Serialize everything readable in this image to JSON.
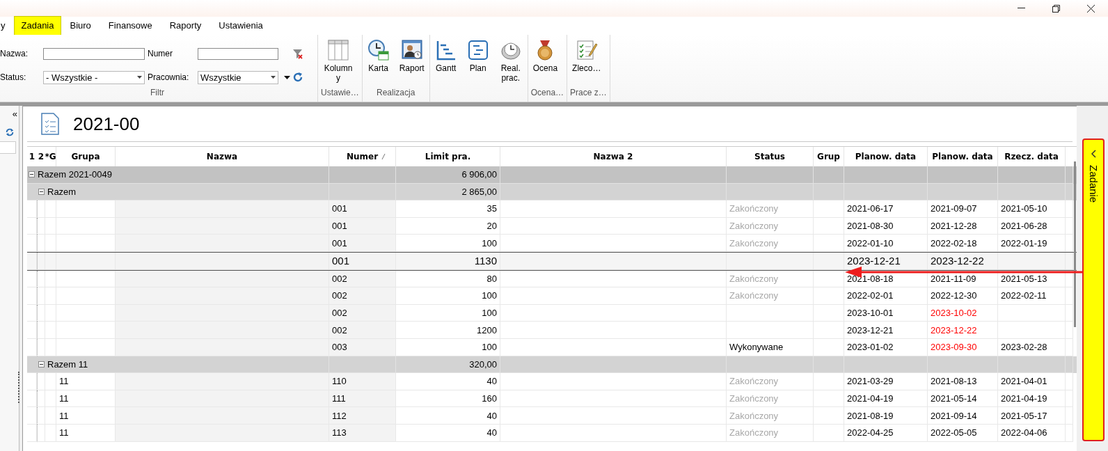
{
  "ribbon": {
    "tabs": [
      {
        "label": "y",
        "selected": false
      },
      {
        "label": "Zadania",
        "selected": true
      },
      {
        "label": "Biuro",
        "selected": false
      },
      {
        "label": "Finansowe",
        "selected": false
      },
      {
        "label": "Raporty",
        "selected": false
      },
      {
        "label": "Ustawienia",
        "selected": false
      }
    ],
    "filter": {
      "label": "Filtr",
      "fields": [
        {
          "kind": "text",
          "label": "Nazwa:"
        },
        {
          "kind": "text",
          "label": "Numer"
        },
        {
          "kind": "dropdown",
          "label": "Status:",
          "value": "- Wszystkie -"
        },
        {
          "kind": "dropdown",
          "label": "Pracownia:",
          "value": "Wszystkie"
        }
      ]
    },
    "groups": [
      {
        "label": "Ustawie…",
        "buttons": [
          {
            "kind": "columns",
            "label": "Kolumny"
          }
        ]
      },
      {
        "label": "Realizacja",
        "buttons": [
          {
            "kind": "calendar",
            "label": "Karta"
          },
          {
            "kind": "report",
            "label": "Raport"
          }
        ]
      },
      {
        "buttons": [
          {
            "kind": "gantt",
            "label": "Gantt"
          },
          {
            "kind": "plan",
            "label": "Plan"
          },
          {
            "kind": "clock",
            "label": "Real. prac."
          }
        ]
      },
      {
        "label": "Ocena…",
        "buttons": [
          {
            "kind": "medal",
            "label": "Ocena"
          }
        ]
      },
      {
        "label": "Prace z…",
        "buttons": [
          {
            "kind": "checklist",
            "label": "Zleco…"
          }
        ]
      }
    ]
  },
  "sidebar": {
    "collapse": "«"
  },
  "document": {
    "title": "2021-00"
  },
  "table": {
    "columns": [
      {
        "label": "1",
        "sorted": false
      },
      {
        "label": "2",
        "sorted": false
      },
      {
        "label": "*G",
        "sorted": false
      },
      {
        "label": "Grupa",
        "sorted": false
      },
      {
        "label": "Nazwa",
        "sorted": false
      },
      {
        "label": "Numer",
        "sorted": true
      },
      {
        "label": "Limit pra.",
        "sorted": false
      },
      {
        "label": "Nazwa 2",
        "sorted": false
      },
      {
        "label": "Status",
        "sorted": false
      },
      {
        "label": "Grup",
        "sorted": false
      },
      {
        "label": "Planow. data",
        "sorted": false
      },
      {
        "label": "Planow. data",
        "sorted": false
      },
      {
        "label": "Rzecz. data",
        "sorted": false
      }
    ],
    "rows": [
      {
        "kind": "group",
        "label": "Razem 2021-0049",
        "limit": "6 906,00",
        "expanded": true,
        "children": [
          {
            "kind": "group",
            "label": "Razem",
            "limit": "2 865,00",
            "expanded": true,
            "children": [
              {
                "kind": "task",
                "numer": "001",
                "limit": "35",
                "status": "Zakończony",
                "finished": true,
                "plan_start": "2021-06-17",
                "plan_end": "2021-09-07",
                "overdue": false,
                "actual": "2021-05-10",
                "highlighted": false
              },
              {
                "kind": "task",
                "numer": "001",
                "limit": "20",
                "status": "Zakończony",
                "finished": true,
                "plan_start": "2021-08-30",
                "plan_end": "2021-12-28",
                "overdue": false,
                "actual": "2021-06-28",
                "highlighted": false
              },
              {
                "kind": "task",
                "numer": "001",
                "limit": "100",
                "status": "Zakończony",
                "finished": true,
                "plan_start": "2022-01-10",
                "plan_end": "2022-02-18",
                "overdue": false,
                "actual": "2022-01-19",
                "highlighted": false
              },
              {
                "kind": "task",
                "numer": "001",
                "limit": "1130",
                "plan_start": "2023-12-21",
                "plan_end": "2023-12-22",
                "overdue": false,
                "highlighted": true
              },
              {
                "kind": "task",
                "numer": "002",
                "limit": "80",
                "status": "Zakończony",
                "finished": true,
                "plan_start": "2021-08-18",
                "plan_end": "2021-11-09",
                "overdue": false,
                "actual": "2021-05-13",
                "highlighted": false
              },
              {
                "kind": "task",
                "numer": "002",
                "limit": "100",
                "status": "Zakończony",
                "finished": true,
                "plan_start": "2022-02-01",
                "plan_end": "2022-12-30",
                "overdue": false,
                "actual": "2022-02-11",
                "highlighted": false
              },
              {
                "kind": "task",
                "numer": "002",
                "limit": "100",
                "plan_start": "2023-10-01",
                "plan_end": "2023-10-02",
                "overdue": true,
                "highlighted": false
              },
              {
                "kind": "task",
                "numer": "002",
                "limit": "1200",
                "plan_start": "2023-12-21",
                "plan_end": "2023-12-22",
                "overdue": true,
                "highlighted": false
              },
              {
                "kind": "task",
                "numer": "003",
                "limit": "100",
                "status": "Wykonywane",
                "finished": false,
                "plan_start": "2023-01-02",
                "plan_end": "2023-09-30",
                "overdue": true,
                "actual": "2023-02-28",
                "highlighted": false
              }
            ]
          },
          {
            "kind": "group",
            "label": "Razem 11",
            "limit": "320,00",
            "expanded": true,
            "children": [
              {
                "kind": "task",
                "grupa": "11",
                "numer": "110",
                "limit": "40",
                "status": "Zakończony",
                "finished": true,
                "plan_start": "2021-03-29",
                "plan_end": "2021-08-13",
                "overdue": false,
                "actual": "2021-04-01",
                "highlighted": false
              },
              {
                "kind": "task",
                "grupa": "11",
                "numer": "111",
                "limit": "160",
                "status": "Zakończony",
                "finished": true,
                "plan_start": "2021-04-19",
                "plan_end": "2021-05-14",
                "overdue": false,
                "actual": "2021-04-19",
                "highlighted": false
              },
              {
                "kind": "task",
                "grupa": "11",
                "numer": "112",
                "limit": "40",
                "status": "Zakończony",
                "finished": true,
                "plan_start": "2021-08-19",
                "plan_end": "2021-09-14",
                "overdue": false,
                "actual": "2021-05-17",
                "highlighted": false
              },
              {
                "kind": "task",
                "grupa": "11",
                "numer": "113",
                "limit": "40",
                "status": "Zakończony",
                "finished": true,
                "plan_start": "2022-04-25",
                "plan_end": "2022-05-05",
                "overdue": false,
                "actual": "2022-04-06",
                "highlighted": false
              }
            ]
          }
        ]
      }
    ]
  },
  "side_tab": {
    "label": "Zadanie"
  }
}
